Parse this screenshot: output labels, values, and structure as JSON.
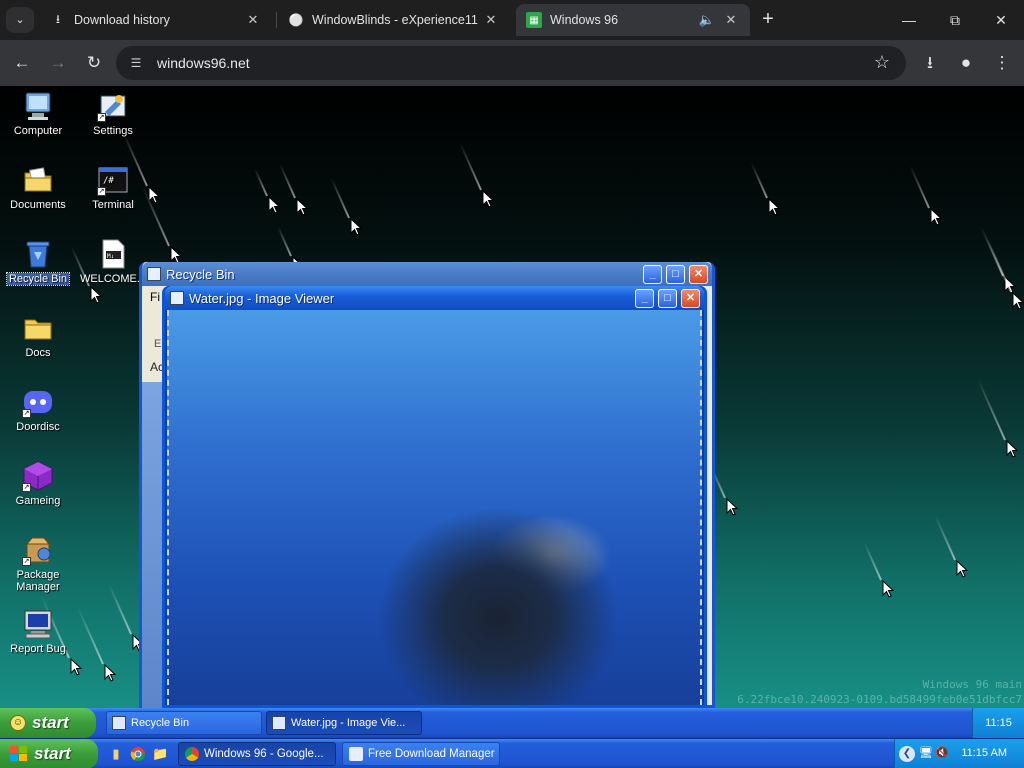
{
  "browser": {
    "tabs": [
      {
        "title": "Download history",
        "icon": "download-icon",
        "active": false
      },
      {
        "title": "WindowBlinds - eXperience11 (",
        "icon": "globe-icon",
        "active": false
      },
      {
        "title": "Windows 96",
        "icon": "windows96-favicon",
        "active": true
      }
    ],
    "url": "windows96.net",
    "accent": "#35363a"
  },
  "desktop": {
    "icons": [
      {
        "label": "Computer"
      },
      {
        "label": "Settings"
      },
      {
        "label": "Documents"
      },
      {
        "label": "Terminal"
      },
      {
        "label": "Recycle Bin"
      },
      {
        "label": "WELCOME..."
      },
      {
        "label": "Docs"
      },
      {
        "label": "Doordisc"
      },
      {
        "label": "Gameing"
      },
      {
        "label": "Package Manager"
      },
      {
        "label": "Report Bug"
      }
    ],
    "watermark_line1": "Windows 96 main",
    "watermark_line2": "6.22fbce10.240923-0109.bd58499feb0e51dbfcc7"
  },
  "windows": {
    "recycle_bin": {
      "title": "Recycle Bin",
      "menu_fragment": "Fi",
      "side_fragment_1": "E",
      "side_fragment_2": "Ac"
    },
    "image_viewer": {
      "title": "Water.jpg - Image Viewer"
    }
  },
  "w96_taskbar": {
    "start_label": "start",
    "tasks": [
      {
        "label": "Recycle Bin",
        "active": false
      },
      {
        "label": "Water.jpg - Image Vie...",
        "active": true
      }
    ],
    "clock": "11:15"
  },
  "host_taskbar": {
    "start_label": "start",
    "tasks": [
      {
        "label": "Windows 96 - Google...",
        "icon": "chrome-icon",
        "active": true
      },
      {
        "label": "Free Download Manager",
        "icon": "fdm-icon",
        "active": false
      }
    ],
    "clock": "11:15 AM"
  }
}
